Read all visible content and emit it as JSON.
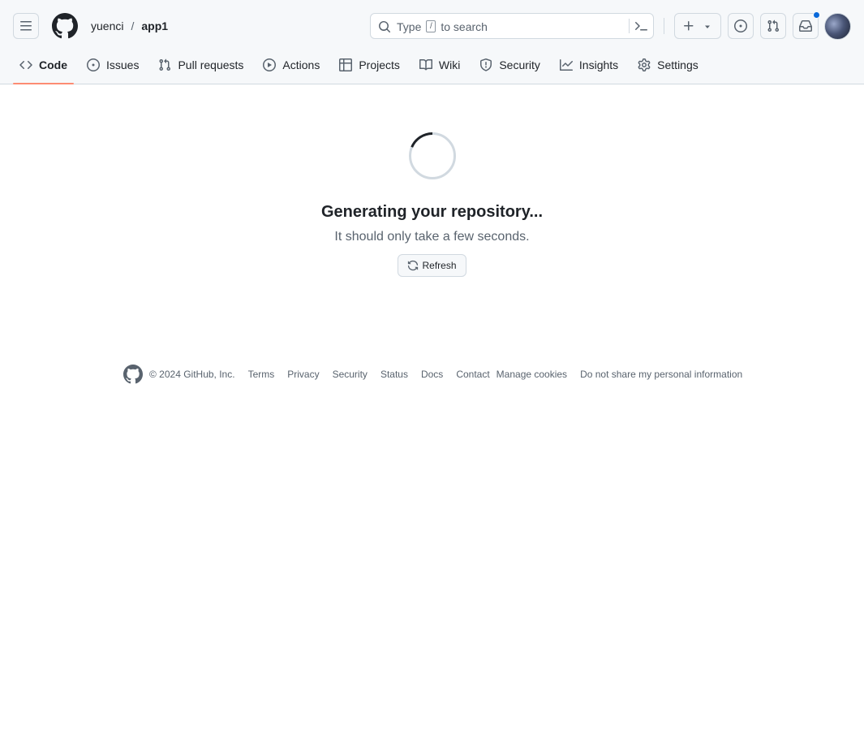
{
  "header": {
    "owner": "yuenci",
    "separator": "/",
    "repo": "app1",
    "search": {
      "prefix": "Type",
      "key": "/",
      "suffix": "to search"
    }
  },
  "tabs": [
    {
      "label": "Code",
      "icon": "code-icon",
      "active": true
    },
    {
      "label": "Issues",
      "icon": "issue-opened-icon"
    },
    {
      "label": "Pull requests",
      "icon": "git-pull-request-icon"
    },
    {
      "label": "Actions",
      "icon": "play-icon"
    },
    {
      "label": "Projects",
      "icon": "table-icon"
    },
    {
      "label": "Wiki",
      "icon": "book-icon"
    },
    {
      "label": "Security",
      "icon": "shield-icon"
    },
    {
      "label": "Insights",
      "icon": "graph-icon"
    },
    {
      "label": "Settings",
      "icon": "gear-icon"
    }
  ],
  "main": {
    "title": "Generating your repository...",
    "subtitle": "It should only take a few seconds.",
    "refresh_label": "Refresh"
  },
  "footer": {
    "copyright": "© 2024 GitHub, Inc.",
    "links": [
      "Terms",
      "Privacy",
      "Security",
      "Status",
      "Docs",
      "Contact",
      "Manage cookies",
      "Do not share my personal information"
    ]
  },
  "colors": {
    "accent_underline": "#fd8c73",
    "notification_dot": "#0969da",
    "header_bg": "#f6f8fa",
    "border": "#d1d9e0",
    "muted_text": "#59636e"
  }
}
